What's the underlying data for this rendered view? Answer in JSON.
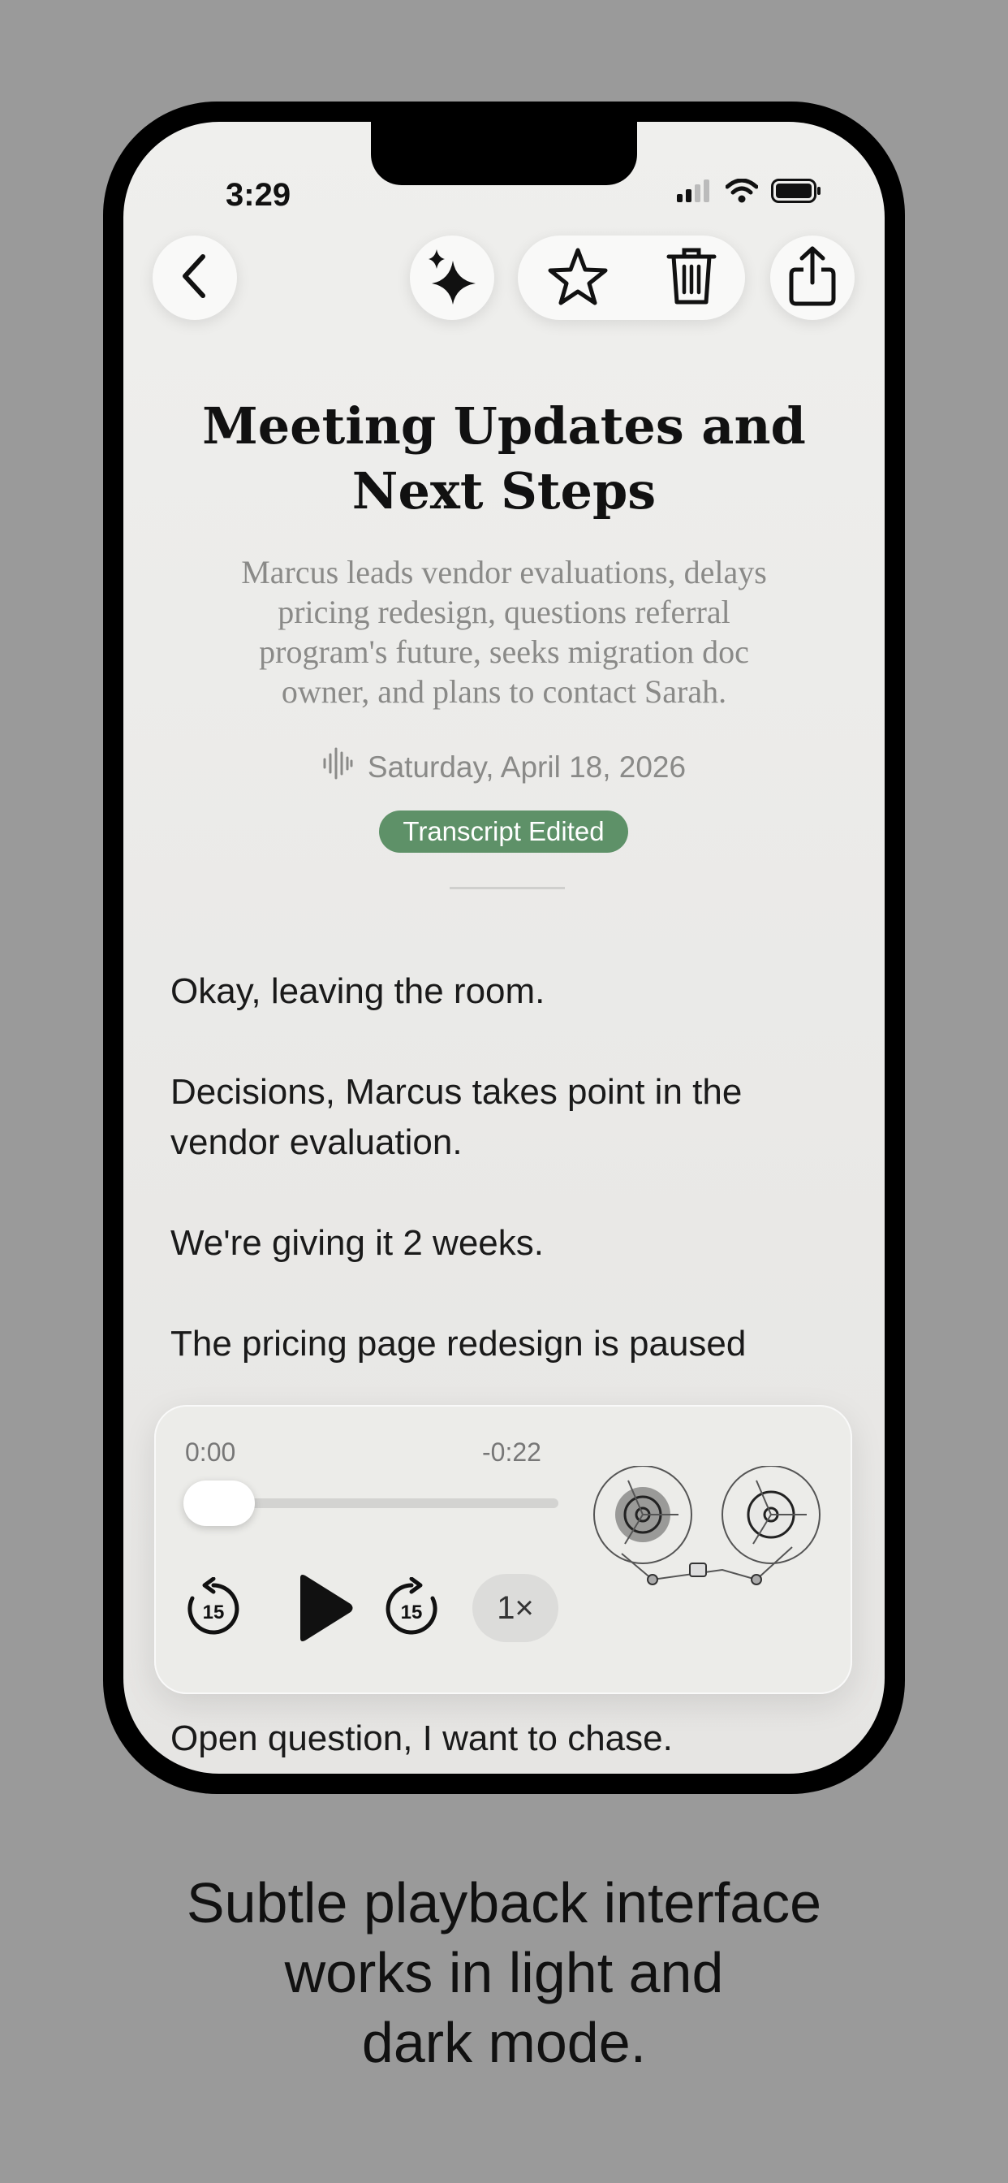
{
  "status_bar": {
    "time": "3:29",
    "icons": [
      "cellular-signal-icon",
      "wifi-icon",
      "battery-icon"
    ]
  },
  "toolbar": {
    "icons": [
      "back-chevron-icon",
      "sparkles-icon",
      "star-icon",
      "trash-icon",
      "share-icon"
    ]
  },
  "note": {
    "title_line1": "Meeting Updates and",
    "title_line2": "Next Steps",
    "summary_line1": "Marcus leads vendor evaluations, delays",
    "summary_line2": "pricing redesign, questions referral",
    "summary_line3": "program's future, seeks migration doc",
    "summary_line4": "owner, and plans to contact Sarah.",
    "date": "Saturday, April 18, 2026",
    "badge": "Transcript Edited",
    "badge_color": "#5e9168"
  },
  "transcript": {
    "p1": "Okay, leaving the room.",
    "p2_line1": "Decisions, Marcus takes point in the",
    "p2_line2": "vendor evaluation.",
    "p3": "We're giving it 2 weeks.",
    "p4": "The pricing page redesign is paused",
    "last": "Open question, I want to chase."
  },
  "player": {
    "elapsed": "0:00",
    "remaining": "-0:22",
    "progress": 0,
    "skip_back_seconds": "15",
    "skip_forward_seconds": "15",
    "speed": "1×"
  },
  "caption": {
    "line1": "Subtle playback interface",
    "line2": "works in light and",
    "line3": "dark mode."
  }
}
